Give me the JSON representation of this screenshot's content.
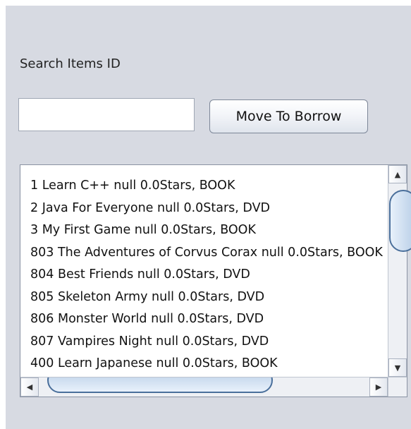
{
  "search": {
    "label": "Search Items ID",
    "value": "",
    "placeholder": ""
  },
  "buttons": {
    "move_to_borrow": "Move To Borrow"
  },
  "items": [
    "1 Learn C++ null 0.0Stars, BOOK",
    "2 Java For Everyone null 0.0Stars, DVD",
    "3 My First Game null 0.0Stars, BOOK",
    "803 The Adventures of Corvus Corax null 0.0Stars, BOOK",
    "804 Best Friends null 0.0Stars, DVD",
    "805 Skeleton Army null 0.0Stars, DVD",
    "806 Monster World null 0.0Stars, DVD",
    "807 Vampires Night null 0.0Stars, DVD",
    "400 Learn Japanese null 0.0Stars, BOOK"
  ],
  "scrollbars": {
    "up_arrow_icon": "up-arrow-icon",
    "down_arrow_icon": "down-arrow-icon",
    "left_arrow_icon": "left-arrow-icon",
    "right_arrow_icon": "right-arrow-icon"
  },
  "colors": {
    "panel_background": "#d7dae2",
    "thumb_border": "#4a6f9b"
  }
}
